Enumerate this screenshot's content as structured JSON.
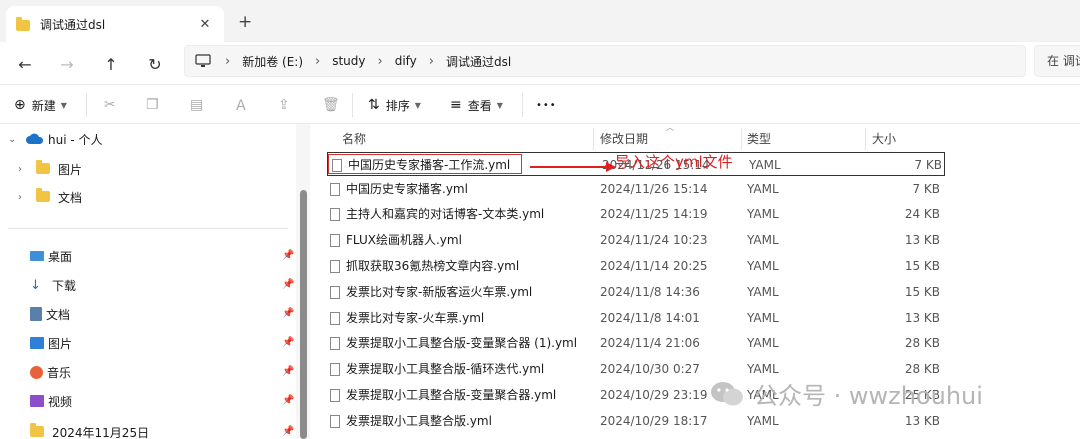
{
  "tab": {
    "title": "调试通过dsl",
    "close": "✕",
    "new": "+"
  },
  "address": {
    "segments": [
      "新加卷 (E:)",
      "study",
      "dify",
      "调试通过dsl"
    ],
    "search_placeholder": "在 调试"
  },
  "toolbar": {
    "new_label": "新建",
    "sort_label": "排序",
    "view_label": "查看",
    "more": "•••"
  },
  "sidebar": {
    "onedrive": "hui - 个人",
    "pictures_sub": "图片",
    "docs_sub": "文档",
    "quick": [
      "桌面",
      "下载",
      "文档",
      "图片",
      "音乐",
      "视频",
      "2024年11月25日"
    ]
  },
  "columns": {
    "name": "名称",
    "date": "修改日期",
    "type": "类型",
    "size": "大小"
  },
  "files": [
    {
      "name": "中国历史专家播客-工作流.yml",
      "date": "2024/11/26 15:14",
      "type": "YAML",
      "size": "7 KB"
    },
    {
      "name": "中国历史专家播客.yml",
      "date": "2024/11/26 15:14",
      "type": "YAML",
      "size": "7 KB"
    },
    {
      "name": "主持人和嘉宾的对话博客-文本类.yml",
      "date": "2024/11/25 14:19",
      "type": "YAML",
      "size": "24 KB"
    },
    {
      "name": "FLUX绘画机器人.yml",
      "date": "2024/11/24 10:23",
      "type": "YAML",
      "size": "13 KB"
    },
    {
      "name": "抓取获取36氪热榜文章内容.yml",
      "date": "2024/11/14 20:25",
      "type": "YAML",
      "size": "15 KB"
    },
    {
      "name": "发票比对专家-新版客运火车票.yml",
      "date": "2024/11/8 14:36",
      "type": "YAML",
      "size": "15 KB"
    },
    {
      "name": "发票比对专家-火车票.yml",
      "date": "2024/11/8 14:01",
      "type": "YAML",
      "size": "13 KB"
    },
    {
      "name": "发票提取小工具整合版-变量聚合器 (1).yml",
      "date": "2024/11/4 21:06",
      "type": "YAML",
      "size": "28 KB"
    },
    {
      "name": "发票提取小工具整合版-循环迭代.yml",
      "date": "2024/10/30 0:27",
      "type": "YAML",
      "size": "28 KB"
    },
    {
      "name": "发票提取小工具整合版-变量聚合器.yml",
      "date": "2024/10/29 23:19",
      "type": "YAML",
      "size": "25 KB"
    },
    {
      "name": "发票提取小工具整合版.yml",
      "date": "2024/10/29 18:17",
      "type": "YAML",
      "size": "13 KB"
    }
  ],
  "annotation": "导入这个yml文件",
  "watermark": "公众号 · wwzhouhui",
  "colors": {
    "annotation": "#e02020",
    "folder": "#f2c443"
  }
}
